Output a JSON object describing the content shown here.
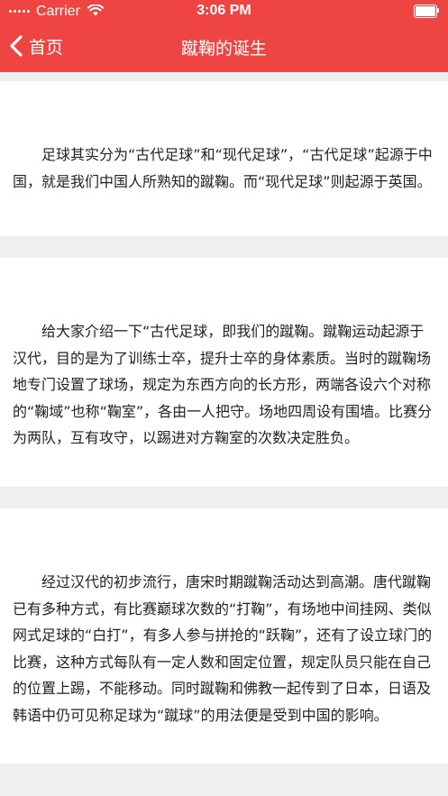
{
  "status_bar": {
    "carrier": "Carrier",
    "time": "3:06 PM",
    "battery_level": 1.0
  },
  "nav": {
    "back_label": "首页",
    "title": "蹴鞠的诞生"
  },
  "paragraphs": [
    "足球其实分为“古代足球”和“现代足球”，“古代足球”起源于中国，就是我们中国人所熟知的蹴鞠。而“现代足球”则起源于英国。",
    "给大家介绍一下“古代足球，即我们的蹴鞠。蹴鞠运动起源于汉代，目的是为了训练士卒，提升士卒的身体素质。当时的蹴鞠场地专门设置了球场，规定为东西方向的长方形，两端各设六个对称的“鞠域”也称“鞠室”，各由一人把守。场地四周设有围墙。比赛分为两队，互有攻守，以踢进对方鞠室的次数决定胜负。",
    "经过汉代的初步流行，唐宋时期蹴鞠活动达到高潮。唐代蹴鞠已有多种方式，有比赛巅球次数的“打鞠”，有场地中间挂网、类似网式足球的“白打”，有多人参与拼抢的“跃鞠”，还有了设立球门的比赛，这种方式每队有一定人数和固定位置，规定队员只能在自己的位置上踢，不能移动。同时蹴鞠和佛教一起传到了日本，日语及韩语中仍可见称足球为“蹴球”的用法便是受到中国的影响。"
  ],
  "colors": {
    "header_background": "#ee4442",
    "page_background": "#efefef",
    "card_background": "#ffffff",
    "text": "#222222"
  },
  "icons": {
    "back": "chevron-left-icon",
    "wifi": "wifi-icon",
    "battery": "battery-icon"
  }
}
